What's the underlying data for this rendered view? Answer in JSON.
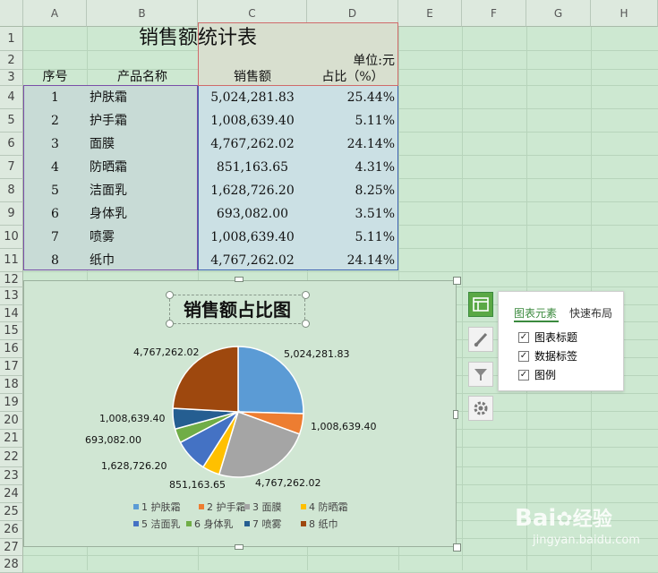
{
  "columns": [
    "A",
    "B",
    "C",
    "D",
    "E",
    "F",
    "G",
    "H"
  ],
  "rows": [
    "1",
    "2",
    "3",
    "4",
    "5",
    "6",
    "7",
    "8",
    "9",
    "10",
    "11",
    "12",
    "13",
    "14",
    "15",
    "16",
    "17",
    "18",
    "19",
    "20",
    "21",
    "22",
    "23",
    "24",
    "25",
    "26",
    "27",
    "28"
  ],
  "sheet": {
    "title": "销售额统计表",
    "unit": "单位:元",
    "headers": [
      "序号",
      "产品名称",
      "销售额",
      "占比（%）"
    ],
    "data": [
      [
        "1",
        "护肤霜",
        "5,024,281.83",
        "25.44%"
      ],
      [
        "2",
        "护手霜",
        "1,008,639.40",
        "5.11%"
      ],
      [
        "3",
        "面膜",
        "4,767,262.02",
        "24.14%"
      ],
      [
        "4",
        "防晒霜",
        "851,163.65",
        "4.31%"
      ],
      [
        "5",
        "洁面乳",
        "1,628,726.20",
        "8.25%"
      ],
      [
        "6",
        "身体乳",
        "693,082.00",
        "3.51%"
      ],
      [
        "7",
        "喷雾",
        "1,008,639.40",
        "5.11%"
      ],
      [
        "8",
        "纸巾",
        "4,767,262.02",
        "24.14%"
      ]
    ]
  },
  "chart_data": {
    "type": "pie",
    "title": "销售额占比图",
    "categories": [
      "1 护肤霜",
      "2 护手霜",
      "3 面膜",
      "4 防晒霜",
      "5 洁面乳",
      "6 身体乳",
      "7 喷雾",
      "8 纸巾"
    ],
    "values": [
      5024281.83,
      1008639.4,
      4767262.02,
      851163.65,
      1628726.2,
      693082.0,
      1008639.4,
      4767262.02
    ],
    "data_labels": [
      "5,024,281.83",
      "1,008,639.40",
      "4,767,262.02",
      "851,163.65",
      "1,628,726.20",
      "693,082.00",
      "1,008,639.40",
      "4,767,262.02"
    ],
    "colors": [
      "#5b9bd5",
      "#ed7d31",
      "#a5a5a5",
      "#ffc000",
      "#4472c4",
      "#70ad47",
      "#255e91",
      "#9e480e"
    ],
    "legend": "bottom"
  },
  "chart_panel": {
    "tabs": [
      "图表元素",
      "快速布局"
    ],
    "options": [
      {
        "label": "图表标题",
        "checked": true
      },
      {
        "label": "数据标签",
        "checked": true
      },
      {
        "label": "图例",
        "checked": true
      }
    ],
    "buttons": [
      "chart-elements-icon",
      "brush-icon",
      "filter-icon",
      "gear-icon"
    ],
    "accent": "#3b8a3e"
  },
  "watermark": {
    "brand": "Bai",
    "brand2": "经验",
    "url": "jingyan.baidu.com"
  }
}
